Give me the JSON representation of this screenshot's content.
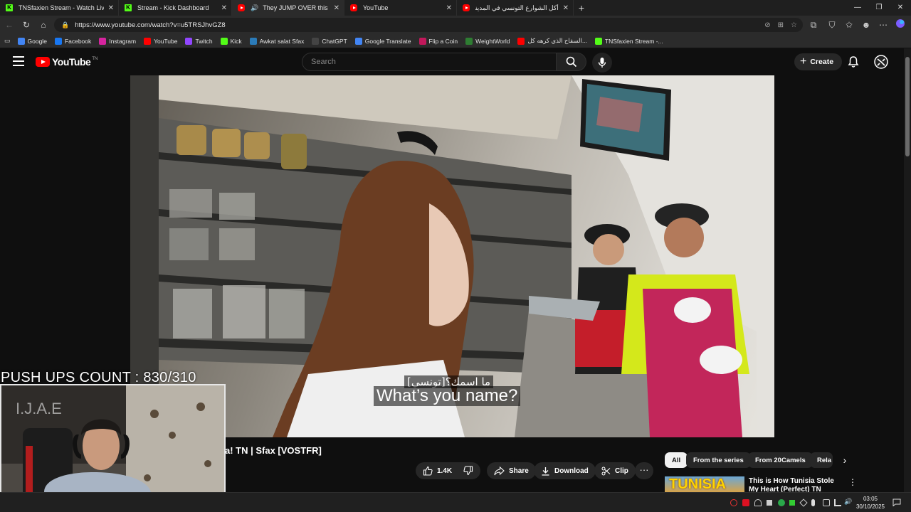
{
  "browser": {
    "tabs": [
      {
        "title": "TNSfaxien Stream - Watch Live on Kick",
        "favicon": "kick-icon",
        "active": false
      },
      {
        "title": "Stream - Kick Dashboard",
        "favicon": "kick-icon",
        "active": false
      },
      {
        "title": "They JUMP OVER this Giant Wall!",
        "favicon": "youtube-icon",
        "active": true,
        "audio": true
      },
      {
        "title": "YouTube",
        "favicon": "youtube-icon",
        "active": false
      },
      {
        "title": "أكل الشوارع التونسي في المدينة الع",
        "favicon": "youtube-icon",
        "active": false
      }
    ],
    "new_tab": "+",
    "window_controls": {
      "minimize": "—",
      "restore": "❐",
      "close": "✕"
    },
    "url": "https://www.youtube.com/watch?v=u5TRSJhvGZ8",
    "bookmarks": [
      {
        "label": "Google",
        "icon": "google-icon",
        "color": "#4285f4"
      },
      {
        "label": "Facebook",
        "icon": "facebook-icon",
        "color": "#1877f2"
      },
      {
        "label": "Instagram",
        "icon": "instagram-icon",
        "color": "#d6249f"
      },
      {
        "label": "YouTube",
        "icon": "youtube-icon",
        "color": "#ff0000"
      },
      {
        "label": "Twitch",
        "icon": "twitch-icon",
        "color": "#9146ff"
      },
      {
        "label": "Kick",
        "icon": "kick-icon",
        "color": "#53fc18"
      },
      {
        "label": "Awkat salat Sfax",
        "icon": "mosque-icon",
        "color": "#2b7bb9"
      },
      {
        "label": "ChatGPT",
        "icon": "chatgpt-icon",
        "color": "#444444"
      },
      {
        "label": "Google Translate",
        "icon": "translate-icon",
        "color": "#4285f4"
      },
      {
        "label": "Flip a Coin",
        "icon": "coin-icon",
        "color": "#c2185b"
      },
      {
        "label": "WeightWorld",
        "icon": "leaf-icon",
        "color": "#2e7d32"
      },
      {
        "label": "السفاح الذي كرهه كل...",
        "icon": "youtube-icon",
        "color": "#ff0000"
      },
      {
        "label": "TNSfaxien Stream -...",
        "icon": "kick-icon",
        "color": "#53fc18"
      }
    ]
  },
  "youtube": {
    "logo_text": "YouTube",
    "country_code": "TN",
    "search_placeholder": "Search",
    "create_label": "Create",
    "video": {
      "subtitle_ar": "[تونسي]ما اسمك؟",
      "subtitle_en": "What’s you name?",
      "title_visible": "a! TN | Sfax [VOSTFR]",
      "likes": "1.4K",
      "share_label": "Share",
      "download_label": "Download",
      "clip_label": "Clip",
      "more_label": "···"
    },
    "chips": [
      {
        "label": "All",
        "selected": true
      },
      {
        "label": "From the series",
        "selected": false
      },
      {
        "label": "From 20Camels",
        "selected": false
      },
      {
        "label": "Rela",
        "selected": false
      }
    ],
    "recommendation": {
      "thumb_text": "TUNISIA",
      "title": "This is How Tunisia Stole My Heart (Perfect) TN"
    }
  },
  "overlay": {
    "pushups": "PUSH UPS COUNT : 830/310"
  },
  "taskbar": {
    "time": "03:05",
    "date": "30/10/2025"
  },
  "colors": {
    "yt_red": "#ff0000",
    "kick_green": "#53fc18",
    "bg": "#0f0f0f"
  }
}
